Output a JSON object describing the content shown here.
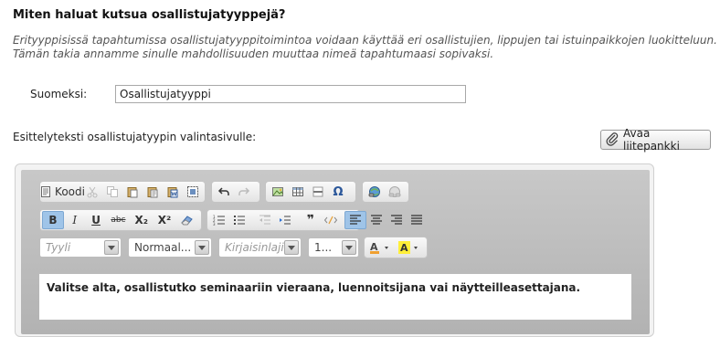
{
  "heading": "Miten haluat kutsua osallistujatyyppejä?",
  "intro": {
    "line1": "Erityyppisissä tapahtumissa osallistujatyyppitoimintoa voidaan käyttää eri osallistujien, lippujen tai istuinpaikkojen luokitteluun.",
    "line2": "Tämän takia annamme sinulle mahdollisuuden muuttaa nimeä tapahtumaasi sopivaksi."
  },
  "name_field": {
    "label": "Suomeksi:",
    "value": "Osallistujatyyppi"
  },
  "description_label": "Esittelyteksti osallistujatyypin valintasivulle:",
  "attachment_button": "Avaa liitepankki",
  "editor": {
    "toolbar": {
      "source_label": "Koodi",
      "bold": "B",
      "italic": "I",
      "underline": "U",
      "strike": "abc",
      "subscript": "X₂",
      "superscript": "X²",
      "quote": "❞"
    },
    "combos": {
      "style": "Tyyli",
      "format": "Normaal...",
      "font": "Kirjaisinlaji",
      "size": "1..."
    },
    "content": "Valitse alta, osallistutko seminaariin vieraana, luennoitsijana vai näytteilleasettajana."
  },
  "colors": {
    "accent_active": "#9fc4e8",
    "toolbar_bg": "#b8b8b8"
  }
}
